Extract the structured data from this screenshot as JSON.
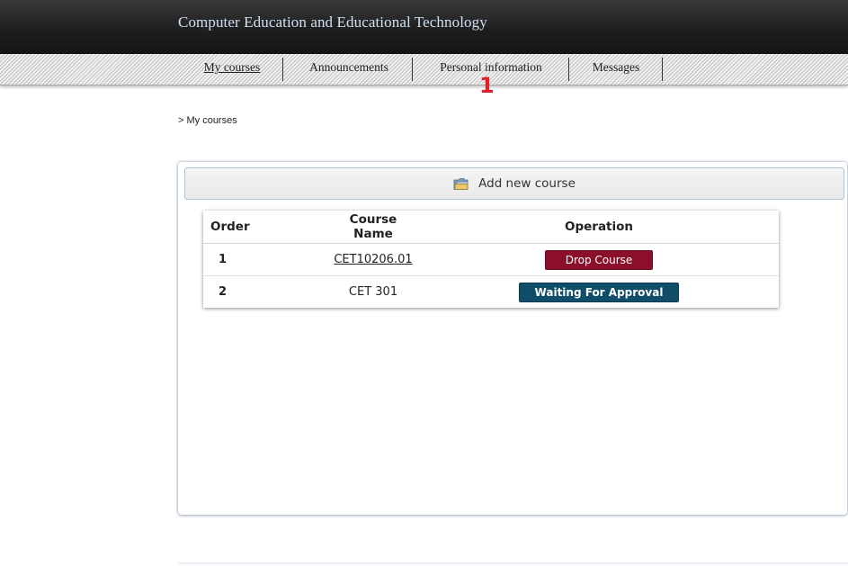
{
  "header": {
    "title": "Computer Education and Educational Technology"
  },
  "nav": {
    "items": [
      {
        "label": "My courses",
        "active": true
      },
      {
        "label": "Announcements"
      },
      {
        "label": "Personal information"
      },
      {
        "label": "Messages"
      }
    ],
    "marker": "1"
  },
  "breadcrumb": "> My courses",
  "panel": {
    "add_label": "Add new course",
    "add_icon": "folder-icon"
  },
  "table": {
    "headers": [
      "Order",
      "Course Name",
      "Operation"
    ],
    "rows": [
      {
        "order": "1",
        "name": "CET10206.01",
        "name_is_link": true,
        "action": "Drop Course",
        "action_color": "#8b0f2a"
      },
      {
        "order": "2",
        "name": "CET 301",
        "name_is_link": false,
        "action": "Waiting For Approval",
        "action_color": "#0f4d68"
      }
    ]
  }
}
